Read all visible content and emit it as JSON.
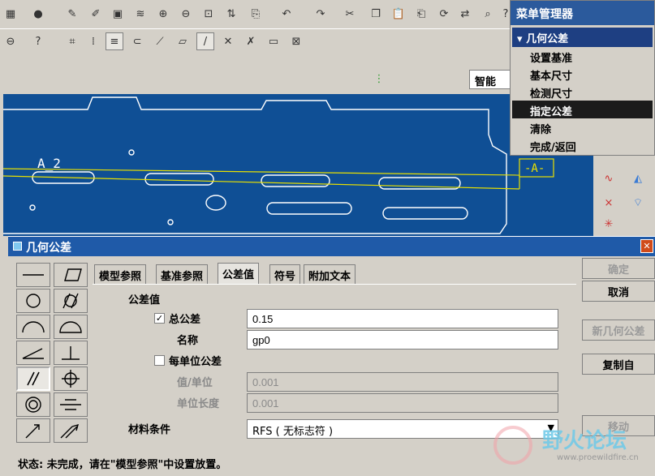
{
  "menu_manager": {
    "title": "菜单管理器",
    "submenu": "几何公差",
    "items": [
      "设置基准",
      "基本尺寸",
      "检测尺寸",
      "指定公差",
      "清除",
      "完成/返回"
    ],
    "active_index": 3
  },
  "toolbar": {
    "smart_filter": "智能"
  },
  "graphics": {
    "datum_labels": [
      "A_2",
      "-A-"
    ]
  },
  "dialog": {
    "title": "几何公差",
    "tabs": [
      "模型参照",
      "基准参照",
      "公差值",
      "符号",
      "附加文本"
    ],
    "active_tab": 2,
    "section_label": "公差值",
    "total_tolerance_label": "总公差",
    "total_tolerance_checked": true,
    "total_tolerance_value": "0.15",
    "name_label": "名称",
    "name_value": "gp0",
    "per_unit_label": "每单位公差",
    "per_unit_checked": false,
    "value_per_unit_label": "值/单位",
    "value_per_unit_value": "0.001",
    "unit_length_label": "单位长度",
    "unit_length_value": "0.001",
    "material_condition_label": "材料条件",
    "material_condition_value": "RFS ( 无标志符 )",
    "buttons": {
      "ok": "确定",
      "cancel": "取消",
      "new": "新几何公差",
      "copy": "复制自",
      "move": "移动"
    },
    "status": "状态: 未完成，请在\"模型参照\"中设置放置。"
  },
  "watermark": {
    "text": "野火论坛",
    "url": "www.proewildfire.cn"
  },
  "colors": {
    "graphics_bg": "#0f4f95",
    "title_bar": "#1f5aa8",
    "menu_active": "#1b1b1b"
  }
}
